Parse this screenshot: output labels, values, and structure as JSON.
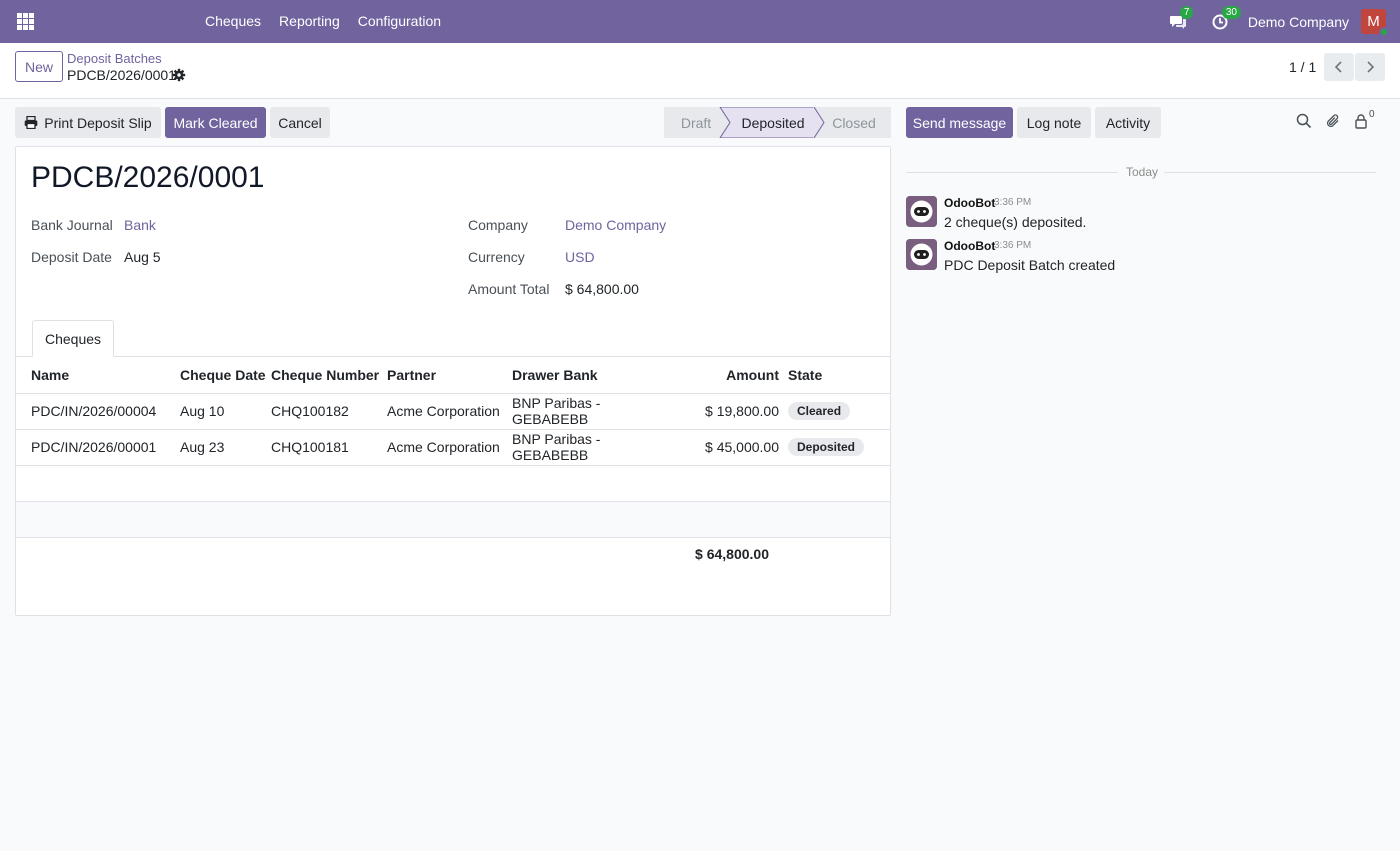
{
  "navbar": {
    "menu": [
      "Cheques",
      "Reporting",
      "Configuration"
    ],
    "messages_count": "7",
    "activities_count": "30",
    "company": "Demo Company",
    "avatar_initial": "M",
    "colors": {
      "brand": "#71639e",
      "avatar": "#c0453d",
      "badge": "#28a745"
    }
  },
  "control_panel": {
    "new_label": "New",
    "breadcrumb_parent": "Deposit Batches",
    "breadcrumb_current": "PDCB/2026/0001",
    "pager_value": "1 / 1"
  },
  "actions": {
    "print_label": "Print Deposit Slip",
    "mark_cleared_label": "Mark Cleared",
    "cancel_label": "Cancel"
  },
  "statusbar": {
    "stages": [
      "Draft",
      "Deposited",
      "Closed"
    ],
    "current": "Deposited"
  },
  "form": {
    "title": "PDCB/2026/0001",
    "bank_journal_label": "Bank Journal",
    "bank_journal_value": "Bank",
    "deposit_date_label": "Deposit Date",
    "deposit_date_value": "Aug 5",
    "company_label": "Company",
    "company_value": "Demo Company",
    "currency_label": "Currency",
    "currency_value": "USD",
    "amount_total_label": "Amount Total",
    "amount_total_value": "$ 64,800.00"
  },
  "tabs": [
    "Cheques"
  ],
  "cheques": {
    "columns": [
      "Name",
      "Cheque Date",
      "Cheque Number",
      "Partner",
      "Drawer Bank",
      "Amount",
      "State"
    ],
    "rows": [
      [
        "PDC/IN/2026/00004",
        "Aug 10",
        "CHQ100182",
        "Acme Corporation",
        "BNP Paribas - GEBABEBB",
        "$ 19,800.00",
        "Cleared"
      ],
      [
        "PDC/IN/2026/00001",
        "Aug 23",
        "CHQ100181",
        "Acme Corporation",
        "BNP Paribas - GEBABEBB",
        "$ 45,000.00",
        "Deposited"
      ]
    ],
    "total": "$ 64,800.00"
  },
  "chatter": {
    "send_message_label": "Send message",
    "log_note_label": "Log note",
    "activity_label": "Activity",
    "followers_count": "0",
    "separator": "Today",
    "messages": [
      {
        "author": "OdooBot",
        "time": "3:36 PM",
        "body": "2 cheque(s) deposited."
      },
      {
        "author": "OdooBot",
        "time": "3:36 PM",
        "body": "PDC Deposit Batch created"
      }
    ]
  }
}
